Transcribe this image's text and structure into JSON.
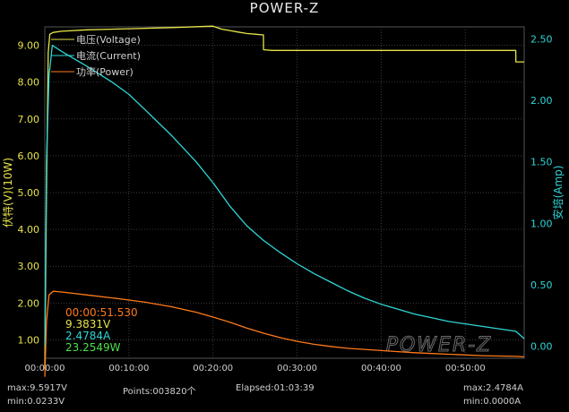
{
  "app_title": "POWER-Z",
  "watermark": "POWER-Z",
  "colors": {
    "background": "#000000",
    "voltage": "#e6e44a",
    "current": "#2fd6d6",
    "power": "#ff7a1a",
    "grid": "#3a3a3a",
    "readout_time": "#ff7a1a",
    "readout_voltage": "#e6e44a",
    "readout_current": "#2fd6d6",
    "readout_power": "#4be04b"
  },
  "readout": {
    "time": "00:00:51.530",
    "voltage": "9.3831V",
    "current": "2.4784A",
    "power": "23.2549W"
  },
  "footer": {
    "max_voltage": "max:9.5917V",
    "min_voltage": "min:0.0233V",
    "points": "Points:003820个",
    "elapsed": "Elapsed:01:03:39",
    "max_current": "max:2.4784A",
    "min_current": "min:0.0000A"
  },
  "chart_data": {
    "type": "line",
    "title": "POWER-Z",
    "xlabel": "",
    "ylabel_left": "伏特(V)(10W)",
    "ylabel_right": "安培(Amp)",
    "x_ticks": [
      "00:00:00",
      "00:10:00",
      "00:20:00",
      "00:30:00",
      "00:40:00",
      "00:50:00"
    ],
    "x_range_minutes": [
      0,
      57
    ],
    "left_ticks": [
      "1.00",
      "2.00",
      "3.00",
      "4.00",
      "5.00",
      "6.00",
      "7.00",
      "8.00",
      "9.00"
    ],
    "left_range": [
      0.5,
      9.5
    ],
    "right_ticks": [
      "0.00",
      "0.50",
      "1.00",
      "1.50",
      "2.00",
      "2.50"
    ],
    "right_range": [
      -0.1,
      2.6
    ],
    "grid": true,
    "legend_placement": "top-left",
    "legend": [
      "电压(Voltage)",
      "电流(Current)",
      "功率(Power)"
    ],
    "series": [
      {
        "name": "电压(Voltage)",
        "axis": "left",
        "x_min": [
          0,
          0.2,
          0.4,
          0.6,
          1,
          2,
          5,
          10,
          15,
          20,
          21,
          22,
          23,
          24,
          25,
          26,
          26.01,
          27,
          30,
          35,
          40,
          45,
          50,
          55,
          56,
          56.01,
          57
        ],
        "y": [
          0.2,
          5,
          8.8,
          9.3,
          9.35,
          9.38,
          9.42,
          9.45,
          9.48,
          9.52,
          9.44,
          9.4,
          9.36,
          9.32,
          9.3,
          9.28,
          8.88,
          8.86,
          8.86,
          8.86,
          8.86,
          8.86,
          8.86,
          8.86,
          8.86,
          8.55,
          8.55
        ]
      },
      {
        "name": "电流(Current)",
        "axis": "right",
        "x_min": [
          0,
          0.2,
          0.5,
          0.9,
          2,
          5,
          8,
          10,
          12,
          15,
          18,
          20,
          22,
          24,
          26,
          28,
          30,
          32,
          34,
          36,
          38,
          40,
          42,
          44,
          46,
          48,
          50,
          52,
          54,
          56,
          57
        ],
        "y": [
          0,
          1.5,
          2.2,
          2.45,
          2.4,
          2.28,
          2.15,
          2.05,
          1.92,
          1.72,
          1.5,
          1.33,
          1.14,
          0.98,
          0.86,
          0.76,
          0.67,
          0.59,
          0.52,
          0.45,
          0.39,
          0.34,
          0.3,
          0.26,
          0.23,
          0.2,
          0.18,
          0.16,
          0.14,
          0.12,
          0.06
        ]
      },
      {
        "name": "功率(Power)",
        "axis": "left",
        "x_min": [
          0,
          0.2,
          0.5,
          1,
          2,
          5,
          8,
          10,
          12,
          15,
          18,
          20,
          22,
          24,
          26,
          28,
          30,
          32,
          34,
          36,
          38,
          40,
          42,
          44,
          46,
          48,
          50,
          52,
          54,
          56,
          57
        ],
        "y": [
          0,
          1.5,
          2.22,
          2.32,
          2.3,
          2.22,
          2.14,
          2.08,
          2.02,
          1.9,
          1.75,
          1.62,
          1.48,
          1.32,
          1.18,
          1.06,
          0.96,
          0.88,
          0.82,
          0.77,
          0.74,
          0.71,
          0.68,
          0.65,
          0.63,
          0.61,
          0.59,
          0.57,
          0.56,
          0.55,
          0.54
        ]
      }
    ]
  }
}
